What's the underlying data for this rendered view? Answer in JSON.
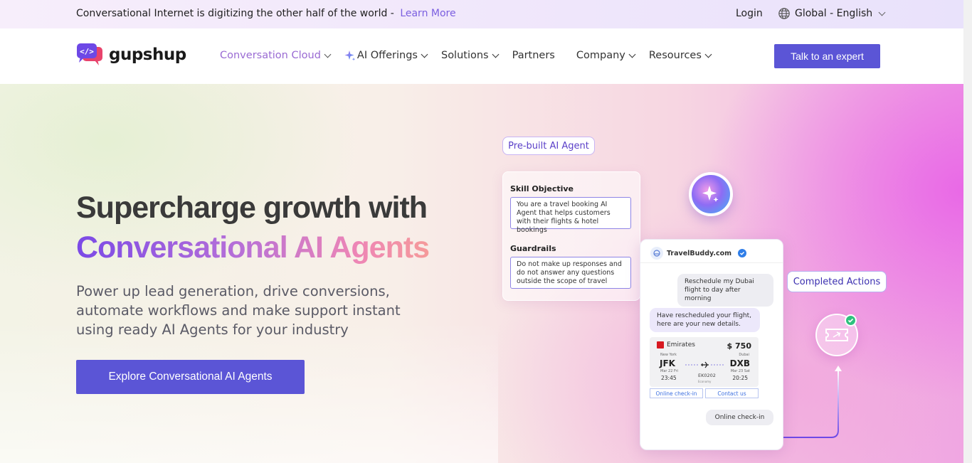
{
  "announcement": {
    "text": "Conversational Internet is digitizing the other half of the world -",
    "link": "Learn More"
  },
  "topbar": {
    "login": "Login",
    "language": "Global - English"
  },
  "brand": {
    "name": "gupshup"
  },
  "nav": {
    "items": [
      {
        "label": "Conversation Cloud",
        "dropdown": true,
        "active": true
      },
      {
        "label": "AI Offerings",
        "dropdown": true,
        "icon": "sparkle-icon"
      },
      {
        "label": "Solutions",
        "dropdown": true
      },
      {
        "label": "Partners",
        "dropdown": false
      },
      {
        "label": "Company",
        "dropdown": true
      },
      {
        "label": "Resources",
        "dropdown": true
      }
    ],
    "cta": "Talk to an expert"
  },
  "hero": {
    "title_line1": "Supercharge growth with",
    "title_line2": "Conversational AI Agents",
    "subtitle": "Power up lead generation, drive conversions, automate workflows and make support instant using ready AI Agents for your industry",
    "button": "Explore Conversational AI Agents"
  },
  "illustration": {
    "prebuilt_label": "Pre-built AI Agent",
    "skill_objective_label": "Skill Objective",
    "skill_objective_text": "You are a travel booking AI Agent that helps customers with their flights & hotel bookings",
    "guardrails_label": "Guardrails",
    "guardrails_text": "Do not make up responses and do not answer any questions outside the scope of travel",
    "phone_title": "TravelBuddy.com",
    "msg_user": "Reschedule my Dubai flight to day after morning",
    "msg_agent": "Have rescheduled your flight, here are your new details.",
    "airline": "Emirates",
    "price": "$ 750",
    "from_city": "New York",
    "from_code": "JFK",
    "from_date": "Mar 22 Fri",
    "from_time": "23:45",
    "to_city": "Dubai",
    "to_code": "DXB",
    "to_date": "Mar 23 Sat",
    "to_time": "20:25",
    "flight_no": "EK0202",
    "flight_class": "Economy",
    "btn_checkin": "Online check-in",
    "btn_contact": "Contact us",
    "msg_user2": "Online check-in",
    "completed_label": "Completed Actions"
  },
  "colors": {
    "accent": "#5b55d6",
    "nav_active": "#9a6bd3",
    "link": "#7b5fe0",
    "success": "#2ec27e"
  }
}
